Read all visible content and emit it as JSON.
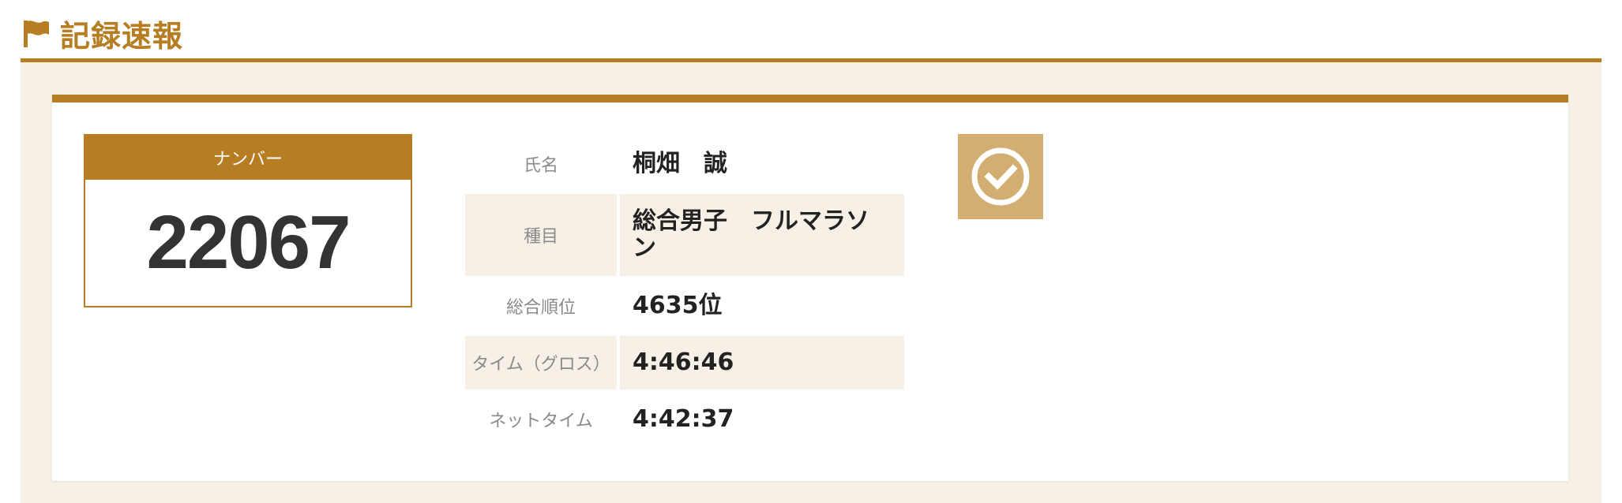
{
  "header": {
    "title": "記録速報",
    "icon": "flag-icon"
  },
  "colors": {
    "accent": "#b77d22",
    "panel_bg": "#f7f0e6",
    "check_bg": "#d3ae72"
  },
  "bib": {
    "label": "ナンバー",
    "number": "22067"
  },
  "details": [
    {
      "label": "氏名",
      "value": "桐畑　誠"
    },
    {
      "label": "種目",
      "value": "総合男子　フルマラソン"
    },
    {
      "label": "総合順位",
      "value": "4635位"
    },
    {
      "label": "タイム（グロス）",
      "value": "4:46:46"
    },
    {
      "label": "ネットタイム",
      "value": "4:42:37"
    }
  ],
  "status_icon": "clock-check-icon"
}
